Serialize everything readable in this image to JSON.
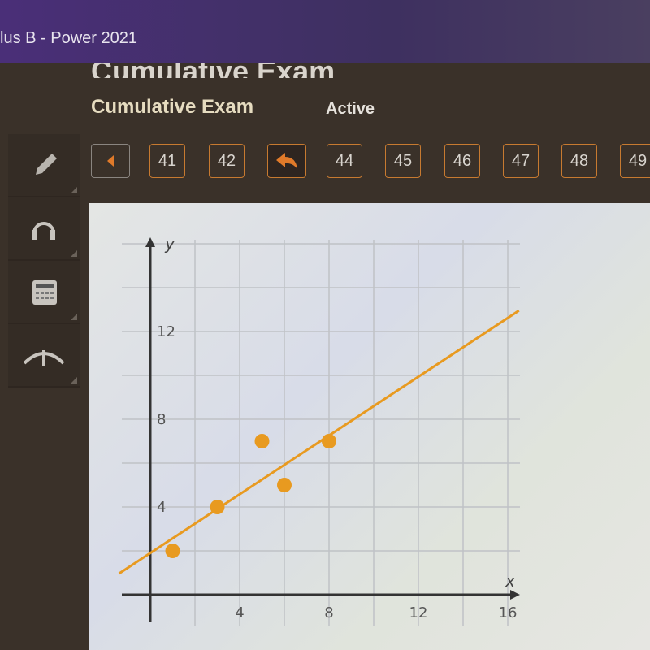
{
  "header": {
    "course": "lus B - Power 2021",
    "title": "Cumulative Exam",
    "subtitle": "Cumulative Exam",
    "status": "Active"
  },
  "sidebar": {
    "tools": [
      {
        "icon": "pencil-icon"
      },
      {
        "icon": "headphones-icon"
      },
      {
        "icon": "calculator-icon"
      },
      {
        "icon": "reference-icon"
      }
    ]
  },
  "nav": {
    "prev_icon": "triangle-left-icon",
    "current_icon": "return-arrow-icon",
    "questions": [
      "41",
      "42",
      "44",
      "45",
      "46",
      "47",
      "48",
      "49"
    ],
    "accent": "#e07a2a"
  },
  "chart_data": {
    "type": "scatter",
    "xlabel": "x",
    "ylabel": "y",
    "xlim": [
      -1.4,
      16.5
    ],
    "ylim": [
      -0.9,
      16
    ],
    "x_ticks": [
      "4",
      "8",
      "12",
      "16"
    ],
    "y_ticks": [
      "4",
      "8",
      "12"
    ],
    "grid": true,
    "grid_step": 2,
    "points": [
      {
        "x": 1,
        "y": 2
      },
      {
        "x": 3,
        "y": 4
      },
      {
        "x": 5,
        "y": 7
      },
      {
        "x": 6,
        "y": 5
      },
      {
        "x": 8,
        "y": 7
      }
    ],
    "trend_line": {
      "slope": 0.67,
      "intercept": 1.9
    },
    "color": "#e89a20"
  }
}
